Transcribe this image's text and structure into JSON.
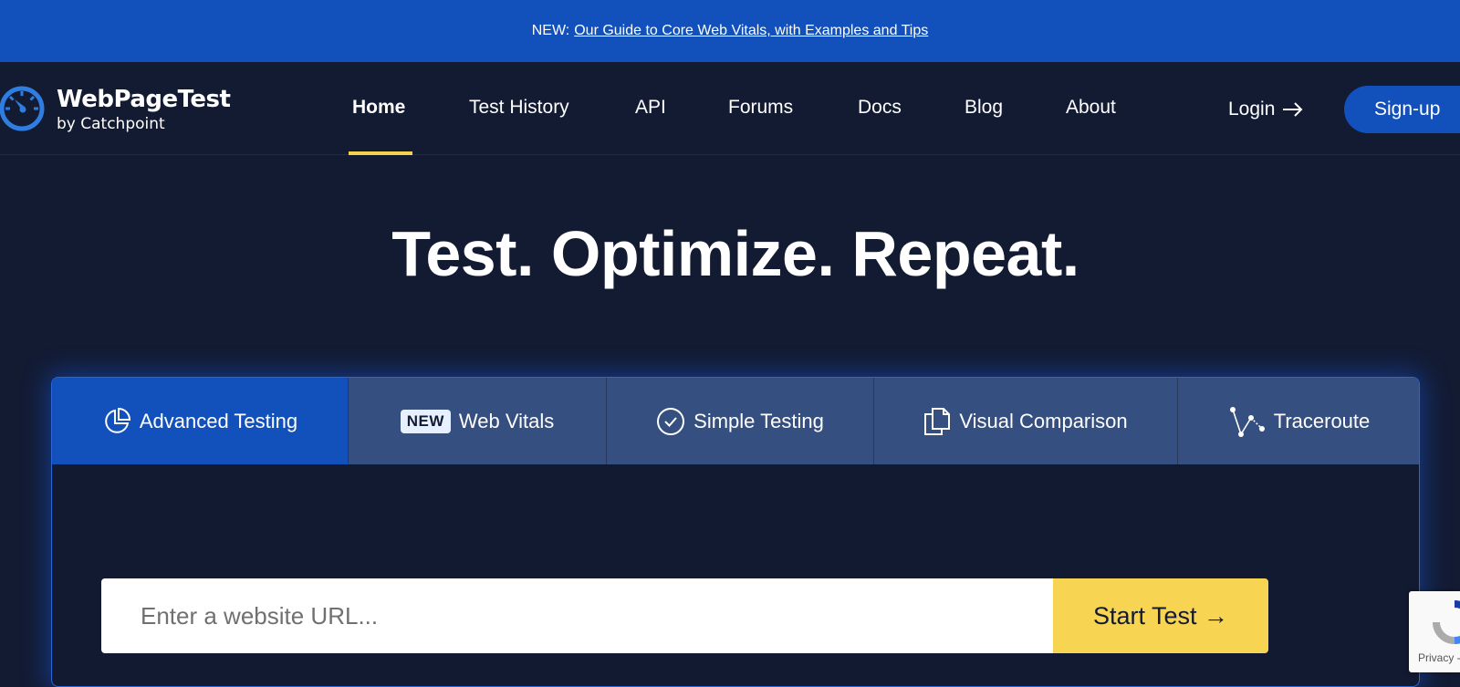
{
  "announcement": {
    "prefix": "NEW:",
    "link_text": "Our Guide to Core Web Vitals, with Examples and Tips"
  },
  "brand": {
    "title": "WebPageTest",
    "subtitle": "by Catchpoint"
  },
  "nav": {
    "items": [
      {
        "label": "Home",
        "active": true
      },
      {
        "label": "Test History"
      },
      {
        "label": "API"
      },
      {
        "label": "Forums"
      },
      {
        "label": "Docs"
      },
      {
        "label": "Blog"
      },
      {
        "label": "About"
      }
    ],
    "login_label": "Login",
    "signup_label": "Sign-up"
  },
  "hero": {
    "title": "Test. Optimize. Repeat."
  },
  "tabs": [
    {
      "label": "Advanced Testing",
      "icon": "pie-chart-icon",
      "active": true
    },
    {
      "label": "Web Vitals",
      "badge": "NEW",
      "icon": "new-badge"
    },
    {
      "label": "Simple Testing",
      "icon": "check-circle-icon"
    },
    {
      "label": "Visual Comparison",
      "icon": "copy-documents-icon"
    },
    {
      "label": "Traceroute",
      "icon": "traceroute-icon"
    }
  ],
  "url_form": {
    "placeholder": "Enter a website URL...",
    "button_label": "Start Test →"
  },
  "recaptcha": {
    "text": "Privacy -"
  },
  "colors": {
    "background": "#131b33",
    "brand_blue": "#1250bc",
    "tab_inactive": "#344f80",
    "accent_yellow": "#f7d452"
  }
}
